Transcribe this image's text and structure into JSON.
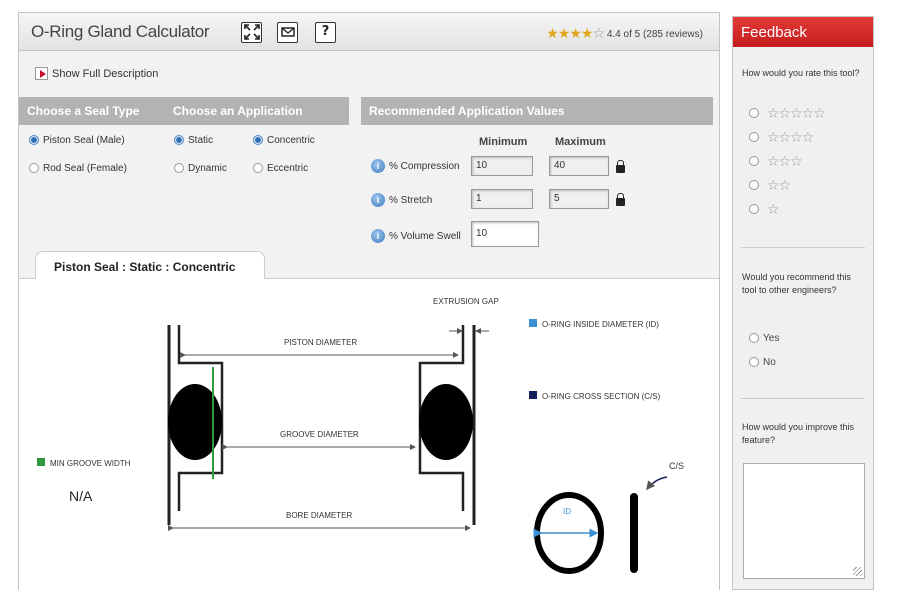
{
  "app": {
    "title": "O-Ring Gland Calculator",
    "icons": [
      "fullscreen-icon",
      "email-icon",
      "help-icon"
    ],
    "rating_text": "4.4 of 5 (285 reviews)",
    "rating_value": 4.4,
    "rating_max": 5
  },
  "description": {
    "link_label": "Show Full Description"
  },
  "seal_type": {
    "header": "Choose a Seal Type",
    "options": [
      {
        "label": "Piston Seal (Male)",
        "selected": true
      },
      {
        "label": "Rod Seal (Female)",
        "selected": false
      }
    ]
  },
  "application": {
    "header": "Choose an Application",
    "options": [
      {
        "label": "Static",
        "selected": true
      },
      {
        "label": "Dynamic",
        "selected": false
      },
      {
        "label": "Concentric",
        "selected": true
      },
      {
        "label": "Eccentric",
        "selected": false
      }
    ]
  },
  "recommended": {
    "header": "Recommended Application Values",
    "col_min": "Minimum",
    "col_max": "Maximum",
    "rows": [
      {
        "label": "% Compression",
        "min": "10",
        "max": "40"
      },
      {
        "label": "% Stretch",
        "min": "1",
        "max": "5"
      },
      {
        "label": "% Volume Swell",
        "value": "10"
      }
    ]
  },
  "diagram": {
    "tab_label": "Piston Seal : Static : Concentric",
    "labels": {
      "extrusion_gap": "EXTRUSION GAP",
      "piston_diameter": "PISTON DIAMETER",
      "groove_diameter": "GROOVE DIAMETER",
      "bore_diameter": "BORE DIAMETER",
      "id_short": "ID",
      "cs_short": "C/S"
    },
    "legend": [
      {
        "label": "O-RING INSIDE DIAMETER (ID)",
        "color": "#3b8fd4"
      },
      {
        "label": "O-RING CROSS SECTION (C/S)",
        "color": "#15205a"
      }
    ],
    "min_groove_width": {
      "label": "MIN GROOVE WIDTH",
      "value": "N/A",
      "color": "#2e9a3a"
    }
  },
  "feedback": {
    "title": "Feedback",
    "q1": "How would you rate this tool?",
    "star_options": [
      5,
      4,
      3,
      2,
      1
    ],
    "q2": "Would you recommend this tool to other engineers?",
    "yes": "Yes",
    "no": "No",
    "q3": "How would you improve this feature?"
  },
  "colors": {
    "accent_red": "#c41c1c",
    "section_gray": "#b3b3b3",
    "star_gold": "#e0a61e"
  }
}
